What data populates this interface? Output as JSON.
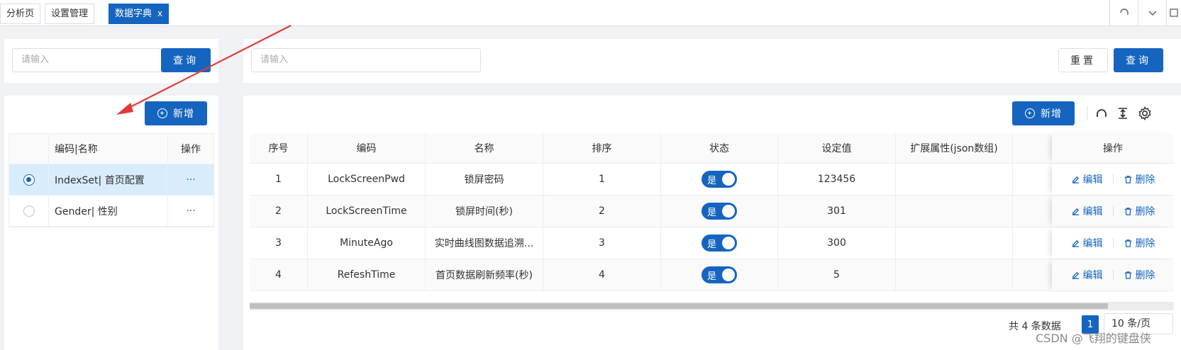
{
  "tabs": [
    {
      "label": "分析页",
      "active": false
    },
    {
      "label": "设置管理",
      "active": false
    },
    {
      "label": "数据字典",
      "active": true,
      "close": "x"
    }
  ],
  "left_search": {
    "placeholder": "请输入",
    "button": "查询"
  },
  "right_search": {
    "placeholder": "请输入",
    "reset": "重置",
    "query": "查询"
  },
  "left_panel": {
    "add_button": "新增",
    "headers": {
      "code_name": "编码|名称",
      "op": "操作"
    },
    "rows": [
      {
        "label": "IndexSet| 首页配置",
        "op": "···",
        "selected": true
      },
      {
        "label": "Gender| 性别",
        "op": "···",
        "selected": false
      }
    ]
  },
  "right_panel": {
    "add_button": "新增",
    "headers": {
      "idx": "序号",
      "code": "编码",
      "name": "名称",
      "sort": "排序",
      "status": "状态",
      "value": "设定值",
      "ext": "扩展属性(json数组)",
      "op": "操作"
    },
    "rows": [
      {
        "idx": "1",
        "code": "LockScreenPwd",
        "name": "锁屏密码",
        "sort": "1",
        "status": "是",
        "value": "123456",
        "ext": ""
      },
      {
        "idx": "2",
        "code": "LockScreenTime",
        "name": "锁屏时间(秒)",
        "sort": "2",
        "status": "是",
        "value": "301",
        "ext": ""
      },
      {
        "idx": "3",
        "code": "MinuteAgo",
        "name": "实时曲线图数据追溯...",
        "sort": "3",
        "status": "是",
        "value": "300",
        "ext": ""
      },
      {
        "idx": "4",
        "code": "RefeshTime",
        "name": "首页数据刷新频率(秒)",
        "sort": "4",
        "status": "是",
        "value": "5",
        "ext": ""
      }
    ],
    "edit_label": "编辑",
    "delete_label": "删除"
  },
  "pagination": {
    "total_text": "共 4 条数据",
    "current_page": "1",
    "page_size": "10 条/页"
  },
  "watermark": "CSDN @飞翔的键盘侠",
  "colors": {
    "primary": "#1565c0",
    "annotation_arrow": "#e53935"
  }
}
